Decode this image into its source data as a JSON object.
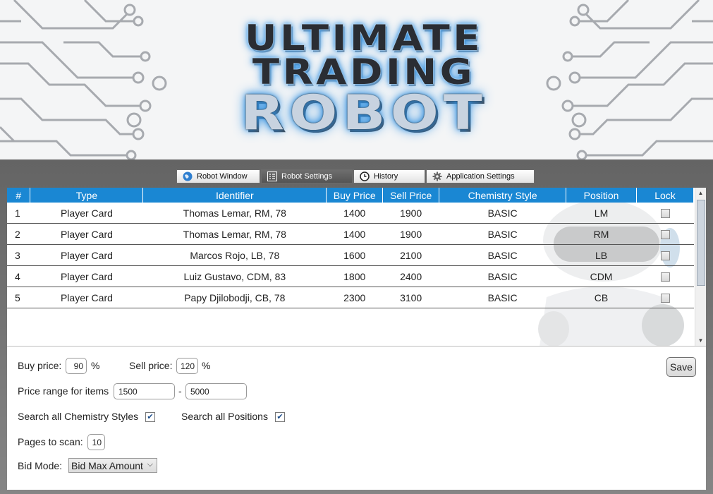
{
  "logo": {
    "line1": "ULTIMATE",
    "line2": "TRADING",
    "line3": "ROBOT"
  },
  "tabs": [
    {
      "label": "Robot Window",
      "icon": "globe-icon",
      "active": false
    },
    {
      "label": "Robot Settings",
      "icon": "list-icon",
      "active": true
    },
    {
      "label": "History",
      "icon": "clock-icon",
      "active": false
    },
    {
      "label": "Application Settings",
      "icon": "gear-icon",
      "active": false
    }
  ],
  "table": {
    "columns": [
      "#",
      "Type",
      "Identifier",
      "Buy Price",
      "Sell Price",
      "Chemistry Style",
      "Position",
      "Lock"
    ],
    "rows": [
      {
        "num": "1",
        "type": "Player Card",
        "identifier": "Thomas Lemar, RM, 78",
        "buy": "1400",
        "sell": "1900",
        "chem": "BASIC",
        "pos": "LM",
        "lock": false
      },
      {
        "num": "2",
        "type": "Player Card",
        "identifier": "Thomas Lemar, RM, 78",
        "buy": "1400",
        "sell": "1900",
        "chem": "BASIC",
        "pos": "RM",
        "lock": false
      },
      {
        "num": "3",
        "type": "Player Card",
        "identifier": "Marcos Rojo, LB, 78",
        "buy": "1600",
        "sell": "2100",
        "chem": "BASIC",
        "pos": "LB",
        "lock": false
      },
      {
        "num": "4",
        "type": "Player Card",
        "identifier": "Luiz Gustavo, CDM, 83",
        "buy": "1800",
        "sell": "2400",
        "chem": "BASIC",
        "pos": "CDM",
        "lock": false
      },
      {
        "num": "5",
        "type": "Player Card",
        "identifier": "Papy Djilobodji, CB, 78",
        "buy": "2300",
        "sell": "3100",
        "chem": "BASIC",
        "pos": "CB",
        "lock": false
      }
    ]
  },
  "settings": {
    "buy_price_label": "Buy price:",
    "buy_price_value": "90",
    "percent": "%",
    "sell_price_label": "Sell price:",
    "sell_price_value": "120",
    "price_range_label": "Price range for items",
    "price_range_min": "1500",
    "price_range_sep": "-",
    "price_range_max": "5000",
    "search_chem_label": "Search all Chemistry Styles",
    "search_chem_checked": true,
    "search_pos_label": "Search all Positions",
    "search_pos_checked": true,
    "pages_label": "Pages to scan:",
    "pages_value": "10",
    "bid_mode_label": "Bid Mode:",
    "bid_mode_value": "Bid Max Amount",
    "save_label": "Save"
  },
  "colors": {
    "header_blue": "#1a87d3",
    "frame_gray": "#6e6e6e",
    "glow_blue": "#2f8fe0"
  }
}
